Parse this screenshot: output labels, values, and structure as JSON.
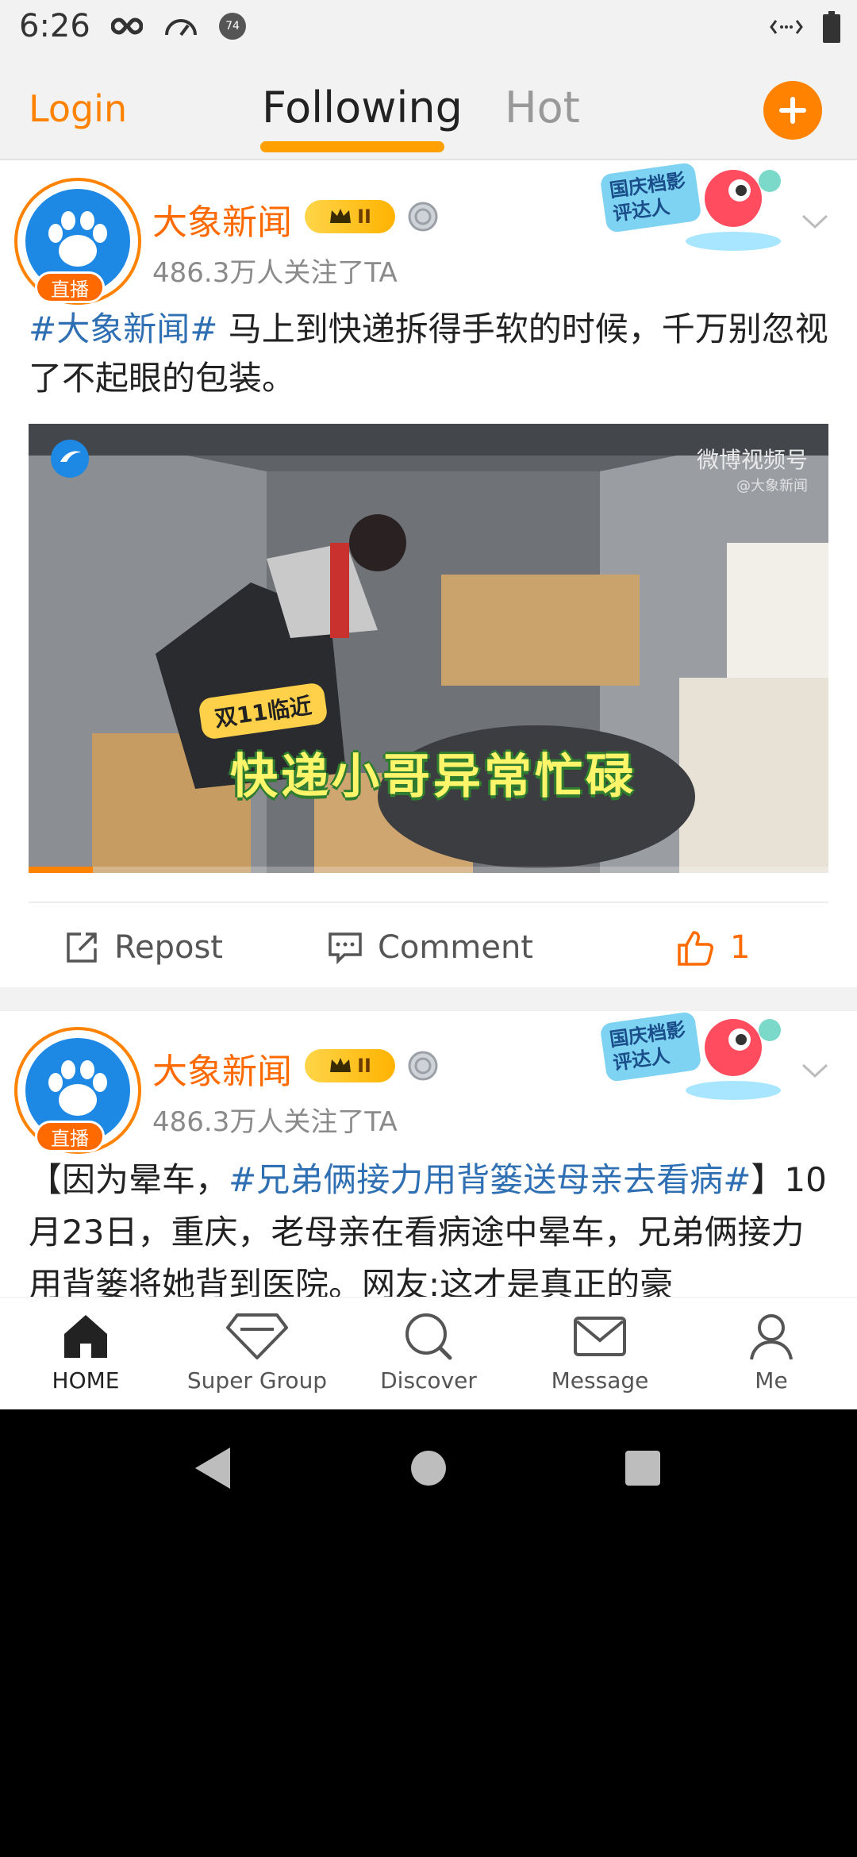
{
  "status_bar": {
    "time": "6:26",
    "left_icons": [
      "infinity-icon",
      "speedometer-icon",
      "notification-badge-icon"
    ],
    "notification_badge_text": "74",
    "right_icons": [
      "data-arrows-icon",
      "battery-icon"
    ]
  },
  "top_nav": {
    "login": "Login",
    "tabs": [
      {
        "label": "Following",
        "active": true
      },
      {
        "label": "Hot",
        "active": false
      }
    ],
    "compose_icon": "plus-icon"
  },
  "posts": [
    {
      "author": "大象新闻",
      "vip_level": "II",
      "live_tag": "直播",
      "followers": "486.3万人关注了TA",
      "promo_text": "国庆档影评达人",
      "text_hashtag": "#大象新闻#",
      "text_body": " 马上到快递拆得手软的时候，千万别忽视了不起眼的包装。",
      "video": {
        "watermark": "微博视频号",
        "watermark_sub": "@大象新闻",
        "tag": "双11临近",
        "caption": "快递小哥异常忙碌",
        "progress": 0.08
      },
      "actions": {
        "repost": "Repost",
        "comment": "Comment",
        "like_count": "1"
      }
    },
    {
      "author": "大象新闻",
      "vip_level": "II",
      "live_tag": "直播",
      "followers": "486.3万人关注了TA",
      "promo_text": "国庆档影评达人",
      "text_prefix": "【因为晕车，",
      "text_hashtag": "#兄弟俩接力用背篓送母亲去看病#",
      "text_suffix": "】10月23日，重庆，老母亲在看病途中晕车，兄弟俩接力用背篓将她背到医院。网友:这才是真正的豪"
    }
  ],
  "bottom_tabs": [
    {
      "label": "HOME",
      "icon": "home-icon",
      "active": true
    },
    {
      "label": "Super Group",
      "icon": "diamond-icon",
      "active": false
    },
    {
      "label": "Discover",
      "icon": "search-icon",
      "active": false
    },
    {
      "label": "Message",
      "icon": "envelope-icon",
      "active": false
    },
    {
      "label": "Me",
      "icon": "person-icon",
      "active": false
    }
  ],
  "colors": {
    "accent": "#ff8200",
    "author": "#ff6a00",
    "hashtag": "#2f6fb3"
  }
}
